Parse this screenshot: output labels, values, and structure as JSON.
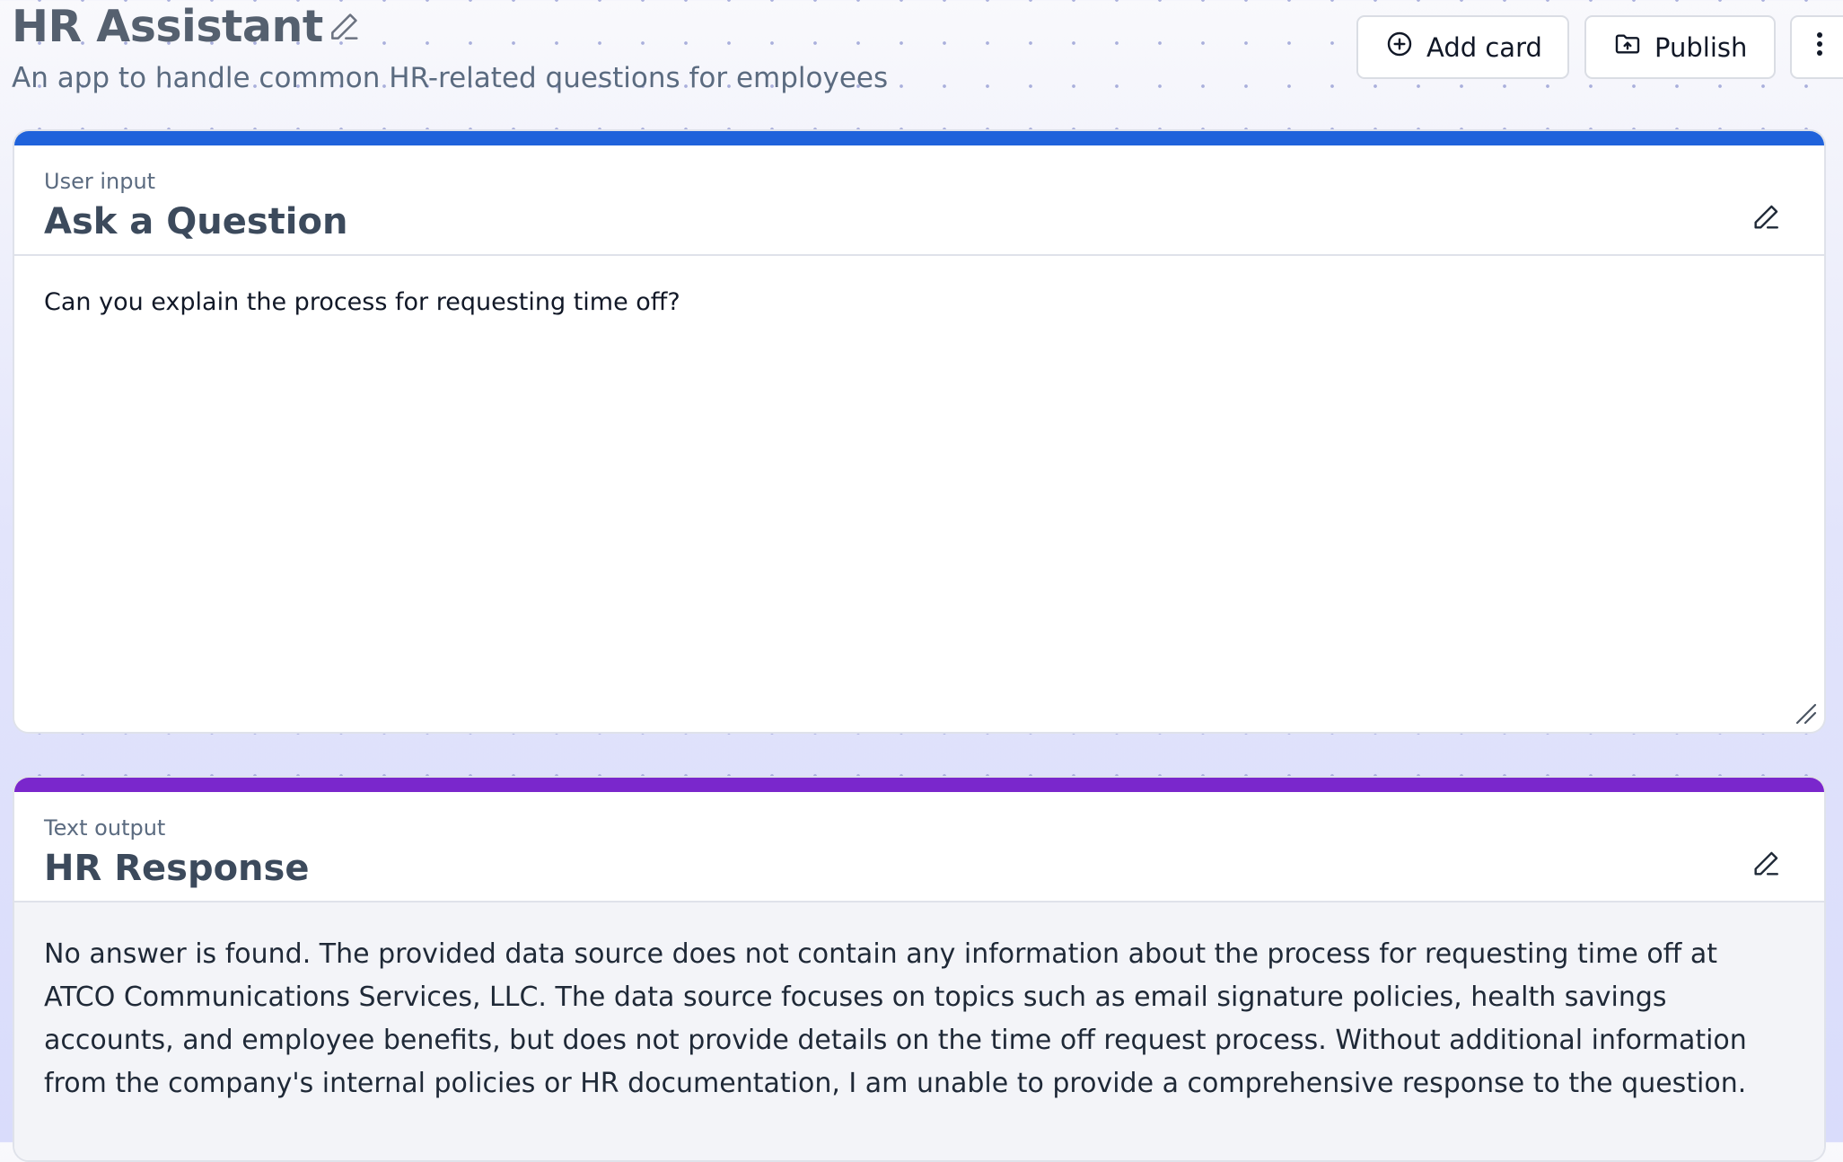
{
  "app": {
    "title": "HR Assistant",
    "description": "An app to handle common HR-related questions for employees"
  },
  "toolbar": {
    "add_card_label": "Add card",
    "add_card_icon": "plus-circle-icon",
    "publish_label": "Publish",
    "publish_icon": "folder-upload-icon",
    "more_icon": "more-vertical-icon"
  },
  "cards": [
    {
      "type_label": "User input",
      "title": "Ask a Question",
      "accent_color": "#1f62db",
      "value": "Can you explain the process for requesting time off?"
    },
    {
      "type_label": "Text output",
      "title": "HR Response",
      "accent_color": "#7a27cc",
      "value": "No answer is found. The provided data source does not contain any information about the process for requesting time off at ATCO Communications Services, LLC. The data source focuses on topics such as email signature policies, health savings accounts, and employee benefits, but does not provide details on the time off request process. Without additional information from the company's internal policies or HR documentation, I am unable to provide a comprehensive response to the question."
    }
  ]
}
